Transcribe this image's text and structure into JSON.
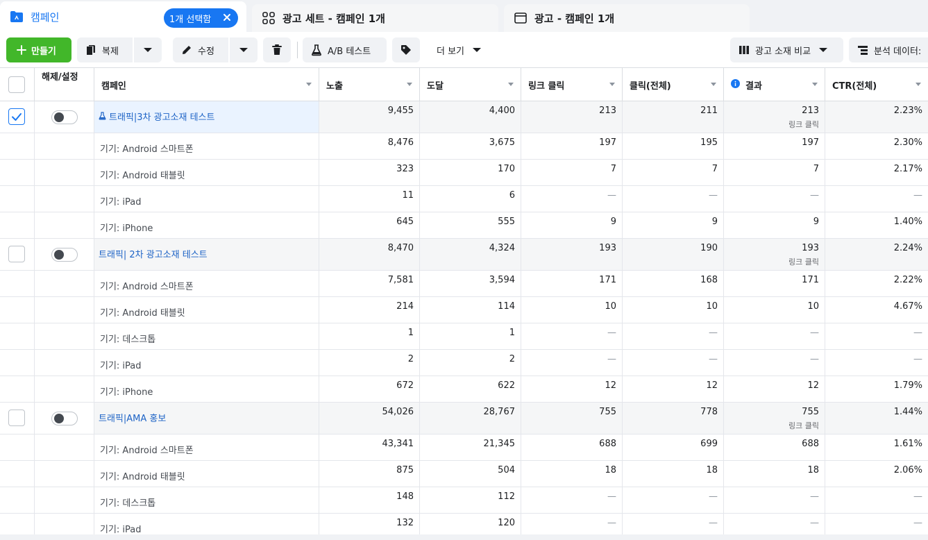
{
  "tabs": {
    "campaign": "캠페인",
    "selected_pill": "1개 선택함",
    "adset": "광고 세트 - 캠페인 1개",
    "ad": "광고 - 캠페인 1개"
  },
  "toolbar": {
    "create": "만들기",
    "duplicate": "복제",
    "edit": "수정",
    "abtest": "A/B 테스트",
    "more": "더 보기",
    "compare": "광고 소재 비교",
    "breakdown": "분석 데이터:"
  },
  "columns": {
    "toggle": "해제/설정",
    "campaign": "캠페인",
    "impressions": "노출",
    "reach": "도달",
    "link_clicks": "링크 클릭",
    "clicks_all": "클릭(전체)",
    "results": "결과",
    "ctr": "CTR(전체)"
  },
  "rows": [
    {
      "type": "campaign",
      "name": "트래픽|3차 광고소재 테스트",
      "flask": true,
      "checked": true,
      "impressions": "9,455",
      "reach": "4,400",
      "link_clicks": "213",
      "clicks_all": "211",
      "results": "213",
      "results_sub": "링크 클릭",
      "ctr": "2.23%"
    },
    {
      "type": "sub",
      "name": "기기: Android 스마트폰",
      "impressions": "8,476",
      "reach": "3,675",
      "link_clicks": "197",
      "clicks_all": "195",
      "results": "197",
      "ctr": "2.30%"
    },
    {
      "type": "sub",
      "name": "기기: Android 태블릿",
      "impressions": "323",
      "reach": "170",
      "link_clicks": "7",
      "clicks_all": "7",
      "results": "7",
      "ctr": "2.17%"
    },
    {
      "type": "sub",
      "name": "기기: iPad",
      "impressions": "11",
      "reach": "6",
      "link_clicks": "—",
      "clicks_all": "—",
      "results": "—",
      "ctr": "—"
    },
    {
      "type": "sub",
      "name": "기기: iPhone",
      "impressions": "645",
      "reach": "555",
      "link_clicks": "9",
      "clicks_all": "9",
      "results": "9",
      "ctr": "1.40%"
    },
    {
      "type": "campaign",
      "name": "트래픽| 2차 광고소재 테스트",
      "flask": false,
      "checked": false,
      "impressions": "8,470",
      "reach": "4,324",
      "link_clicks": "193",
      "clicks_all": "190",
      "results": "193",
      "results_sub": "링크 클릭",
      "ctr": "2.24%"
    },
    {
      "type": "sub",
      "name": "기기: Android 스마트폰",
      "impressions": "7,581",
      "reach": "3,594",
      "link_clicks": "171",
      "clicks_all": "168",
      "results": "171",
      "ctr": "2.22%"
    },
    {
      "type": "sub",
      "name": "기기: Android 태블릿",
      "impressions": "214",
      "reach": "114",
      "link_clicks": "10",
      "clicks_all": "10",
      "results": "10",
      "ctr": "4.67%"
    },
    {
      "type": "sub",
      "name": "기기: 데스크톱",
      "impressions": "1",
      "reach": "1",
      "link_clicks": "—",
      "clicks_all": "—",
      "results": "—",
      "ctr": "—"
    },
    {
      "type": "sub",
      "name": "기기: iPad",
      "impressions": "2",
      "reach": "2",
      "link_clicks": "—",
      "clicks_all": "—",
      "results": "—",
      "ctr": "—"
    },
    {
      "type": "sub",
      "name": "기기: iPhone",
      "impressions": "672",
      "reach": "622",
      "link_clicks": "12",
      "clicks_all": "12",
      "results": "12",
      "ctr": "1.79%"
    },
    {
      "type": "campaign",
      "name": "트래픽|AMA 홍보",
      "flask": false,
      "checked": false,
      "impressions": "54,026",
      "reach": "28,767",
      "link_clicks": "755",
      "clicks_all": "778",
      "results": "755",
      "results_sub": "링크 클릭",
      "ctr": "1.44%"
    },
    {
      "type": "sub",
      "name": "기기: Android 스마트폰",
      "impressions": "43,341",
      "reach": "21,345",
      "link_clicks": "688",
      "clicks_all": "699",
      "results": "688",
      "ctr": "1.61%"
    },
    {
      "type": "sub",
      "name": "기기: Android 태블릿",
      "impressions": "875",
      "reach": "504",
      "link_clicks": "18",
      "clicks_all": "18",
      "results": "18",
      "ctr": "2.06%"
    },
    {
      "type": "sub",
      "name": "기기: 데스크톱",
      "impressions": "148",
      "reach": "112",
      "link_clicks": "—",
      "clicks_all": "—",
      "results": "—",
      "ctr": "—"
    },
    {
      "type": "sub",
      "name": "기기: iPad",
      "impressions": "132",
      "reach": "120",
      "link_clicks": "—",
      "clicks_all": "—",
      "results": "—",
      "ctr": "—"
    }
  ],
  "colors": {
    "accent": "#1877f2",
    "create_green": "#42b72a",
    "link_blue": "#1d63c6",
    "campaign_row_bg": "#f5f6f7",
    "selected_cell_bg": "#eaf3ff"
  }
}
